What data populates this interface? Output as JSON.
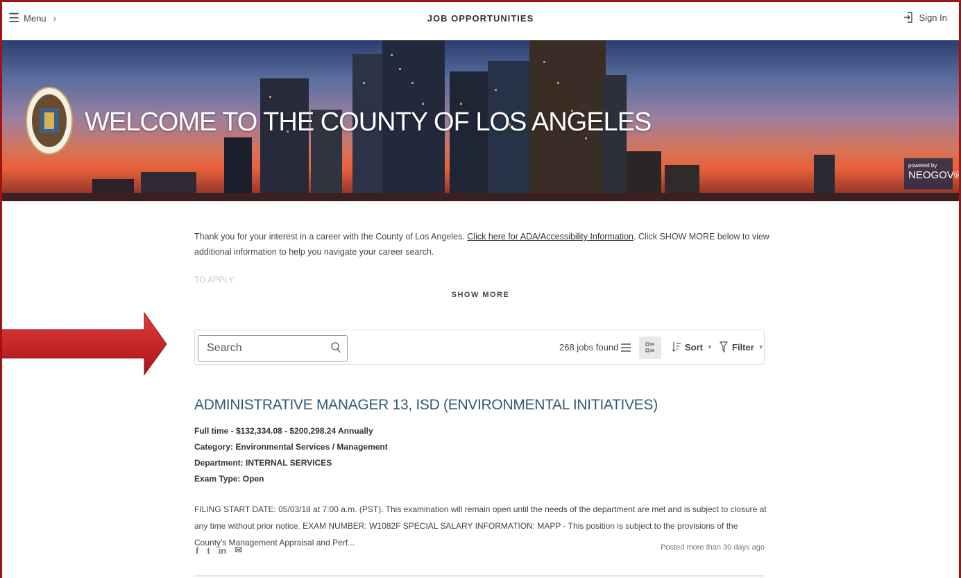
{
  "topbar": {
    "menu_label": "Menu",
    "title": "JOB OPPORTUNITIES",
    "signin_label": "Sign In"
  },
  "banner": {
    "title": "WELCOME TO THE COUNTY OF LOS ANGELES",
    "powered_by": "powered by",
    "brand": "NEOGOV®"
  },
  "intro": {
    "text_before_link": "Thank you for your interest in a career with the County of Los Angeles. ",
    "link_text": "Click here for ADA/Accessibility Information",
    "text_after_link": ". Click SHOW MORE below to view additional information to help you navigate your career search.",
    "to_apply": "TO APPLY:",
    "show_more": "SHOW MORE"
  },
  "toolbar": {
    "search_placeholder": "Search",
    "jobs_found": "268 jobs found",
    "sort_label": "Sort",
    "filter_label": "Filter"
  },
  "job": {
    "title": "ADMINISTRATIVE MANAGER 13, ISD (ENVIRONMENTAL INITIATIVES)",
    "salary": "Full time - $132,334.08 - $200,298.24 Annually",
    "category": "Category: Environmental Services / Management",
    "department": "Department: INTERNAL SERVICES",
    "exam_type": "Exam Type: Open",
    "description": "FILING START DATE:  05/03/18 at 7:00 a.m. (PST).  This examination will remain open until the needs of the department are met and is subject to closure at any time without prior notice. EXAM NUMBER:  W1082F SPECIAL SALARY INFORMATION:  MAPP - This position is subject to the provisions of the County's Management Appraisal and Perf...",
    "posted": "Posted more than 30 days ago",
    "share": {
      "facebook": "f",
      "twitter": "t",
      "linkedin": "in",
      "email": "✉"
    }
  },
  "colors": {
    "frame": "#a31212",
    "job_title": "#2f5a78",
    "arrow": "#c0191c"
  }
}
